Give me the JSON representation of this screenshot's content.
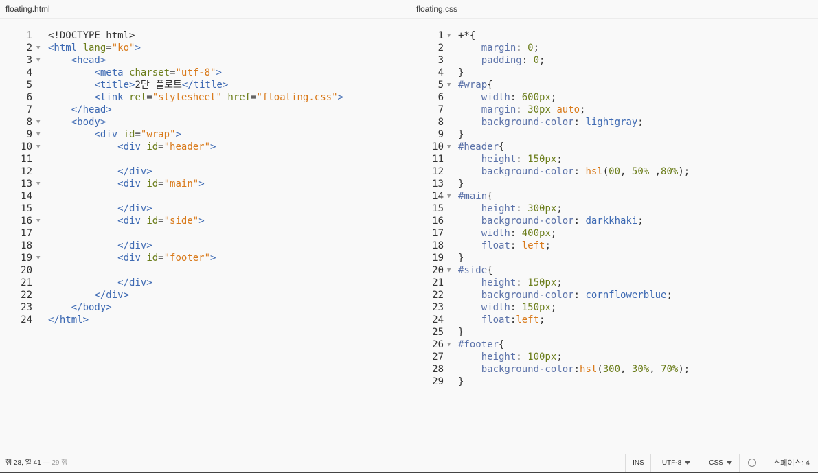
{
  "left_pane": {
    "filename": "floating.html",
    "lines": [
      {
        "n": "1",
        "fold": false,
        "tokens": [
          [
            "plain",
            "<!DOCTYPE html>"
          ]
        ]
      },
      {
        "n": "2",
        "fold": true,
        "tokens": [
          [
            "tag",
            "<html "
          ],
          [
            "attr",
            "lang"
          ],
          [
            "plain",
            "="
          ],
          [
            "str",
            "\"ko\""
          ],
          [
            "tag",
            ">"
          ]
        ]
      },
      {
        "n": "3",
        "fold": true,
        "tokens": [
          [
            "plain",
            "    "
          ],
          [
            "tag",
            "<head>"
          ]
        ]
      },
      {
        "n": "4",
        "fold": false,
        "tokens": [
          [
            "plain",
            "        "
          ],
          [
            "tag",
            "<meta "
          ],
          [
            "attr",
            "charset"
          ],
          [
            "plain",
            "="
          ],
          [
            "str",
            "\"utf-8\""
          ],
          [
            "tag",
            ">"
          ]
        ]
      },
      {
        "n": "5",
        "fold": false,
        "tokens": [
          [
            "plain",
            "        "
          ],
          [
            "tag",
            "<title>"
          ],
          [
            "plain",
            "2단 플로트"
          ],
          [
            "tag",
            "</title>"
          ]
        ]
      },
      {
        "n": "6",
        "fold": false,
        "tokens": [
          [
            "plain",
            "        "
          ],
          [
            "tag",
            "<link "
          ],
          [
            "attr",
            "rel"
          ],
          [
            "plain",
            "="
          ],
          [
            "str",
            "\"stylesheet\""
          ],
          [
            "plain",
            " "
          ],
          [
            "attr",
            "href"
          ],
          [
            "plain",
            "="
          ],
          [
            "str",
            "\"floating.css\""
          ],
          [
            "tag",
            ">"
          ]
        ]
      },
      {
        "n": "7",
        "fold": false,
        "tokens": [
          [
            "plain",
            "    "
          ],
          [
            "tag",
            "</head>"
          ]
        ]
      },
      {
        "n": "8",
        "fold": true,
        "tokens": [
          [
            "plain",
            "    "
          ],
          [
            "tag",
            "<body>"
          ]
        ]
      },
      {
        "n": "9",
        "fold": true,
        "tokens": [
          [
            "plain",
            "        "
          ],
          [
            "tag",
            "<div "
          ],
          [
            "attr",
            "id"
          ],
          [
            "plain",
            "="
          ],
          [
            "str",
            "\"wrap\""
          ],
          [
            "tag",
            ">"
          ]
        ]
      },
      {
        "n": "10",
        "fold": true,
        "tokens": [
          [
            "plain",
            "            "
          ],
          [
            "tag",
            "<div "
          ],
          [
            "attr",
            "id"
          ],
          [
            "plain",
            "="
          ],
          [
            "str",
            "\"header\""
          ],
          [
            "tag",
            ">"
          ]
        ]
      },
      {
        "n": "11",
        "fold": false,
        "tokens": []
      },
      {
        "n": "12",
        "fold": false,
        "tokens": [
          [
            "plain",
            "            "
          ],
          [
            "tag",
            "</div>"
          ]
        ]
      },
      {
        "n": "13",
        "fold": true,
        "tokens": [
          [
            "plain",
            "            "
          ],
          [
            "tag",
            "<div "
          ],
          [
            "attr",
            "id"
          ],
          [
            "plain",
            "="
          ],
          [
            "str",
            "\"main\""
          ],
          [
            "tag",
            ">"
          ]
        ]
      },
      {
        "n": "14",
        "fold": false,
        "tokens": []
      },
      {
        "n": "15",
        "fold": false,
        "tokens": [
          [
            "plain",
            "            "
          ],
          [
            "tag",
            "</div>"
          ]
        ]
      },
      {
        "n": "16",
        "fold": true,
        "tokens": [
          [
            "plain",
            "            "
          ],
          [
            "tag",
            "<div "
          ],
          [
            "attr",
            "id"
          ],
          [
            "plain",
            "="
          ],
          [
            "str",
            "\"side\""
          ],
          [
            "tag",
            ">"
          ]
        ]
      },
      {
        "n": "17",
        "fold": false,
        "tokens": []
      },
      {
        "n": "18",
        "fold": false,
        "tokens": [
          [
            "plain",
            "            "
          ],
          [
            "tag",
            "</div>"
          ]
        ]
      },
      {
        "n": "19",
        "fold": true,
        "tokens": [
          [
            "plain",
            "            "
          ],
          [
            "tag",
            "<div "
          ],
          [
            "attr",
            "id"
          ],
          [
            "plain",
            "="
          ],
          [
            "str",
            "\"footer\""
          ],
          [
            "tag",
            ">"
          ]
        ]
      },
      {
        "n": "20",
        "fold": false,
        "tokens": []
      },
      {
        "n": "21",
        "fold": false,
        "tokens": [
          [
            "plain",
            "            "
          ],
          [
            "tag",
            "</div>"
          ]
        ]
      },
      {
        "n": "22",
        "fold": false,
        "tokens": [
          [
            "plain",
            "        "
          ],
          [
            "tag",
            "</div>"
          ]
        ]
      },
      {
        "n": "23",
        "fold": false,
        "tokens": [
          [
            "plain",
            "    "
          ],
          [
            "tag",
            "</body>"
          ]
        ]
      },
      {
        "n": "24",
        "fold": false,
        "tokens": [
          [
            "tag",
            "</html>"
          ]
        ]
      }
    ]
  },
  "right_pane": {
    "filename": "floating.css",
    "lines": [
      {
        "n": "1",
        "fold": true,
        "tokens": [
          [
            "plain",
            "+*{"
          ]
        ]
      },
      {
        "n": "2",
        "fold": false,
        "tokens": [
          [
            "plain",
            "    "
          ],
          [
            "prop",
            "margin"
          ],
          [
            "plain",
            ": "
          ],
          [
            "num",
            "0"
          ],
          [
            "plain",
            ";"
          ]
        ]
      },
      {
        "n": "3",
        "fold": false,
        "tokens": [
          [
            "plain",
            "    "
          ],
          [
            "prop",
            "padding"
          ],
          [
            "plain",
            ": "
          ],
          [
            "num",
            "0"
          ],
          [
            "plain",
            ";"
          ]
        ]
      },
      {
        "n": "4",
        "fold": false,
        "tokens": [
          [
            "plain",
            "}"
          ]
        ]
      },
      {
        "n": "5",
        "fold": true,
        "tokens": [
          [
            "sel",
            "#wrap"
          ],
          [
            "plain",
            "{"
          ]
        ]
      },
      {
        "n": "6",
        "fold": false,
        "tokens": [
          [
            "plain",
            "    "
          ],
          [
            "prop",
            "width"
          ],
          [
            "plain",
            ": "
          ],
          [
            "num",
            "600px"
          ],
          [
            "plain",
            ";"
          ]
        ]
      },
      {
        "n": "7",
        "fold": false,
        "tokens": [
          [
            "plain",
            "    "
          ],
          [
            "prop",
            "margin"
          ],
          [
            "plain",
            ": "
          ],
          [
            "num",
            "30px"
          ],
          [
            "plain",
            " "
          ],
          [
            "kw",
            "auto"
          ],
          [
            "plain",
            ";"
          ]
        ]
      },
      {
        "n": "8",
        "fold": false,
        "tokens": [
          [
            "plain",
            "    "
          ],
          [
            "prop",
            "background-color"
          ],
          [
            "plain",
            ": "
          ],
          [
            "tag",
            "lightgray"
          ],
          [
            "plain",
            ";"
          ]
        ]
      },
      {
        "n": "9",
        "fold": false,
        "tokens": [
          [
            "plain",
            "}"
          ]
        ]
      },
      {
        "n": "10",
        "fold": true,
        "tokens": [
          [
            "sel",
            "#header"
          ],
          [
            "plain",
            "{"
          ]
        ]
      },
      {
        "n": "11",
        "fold": false,
        "tokens": [
          [
            "plain",
            "    "
          ],
          [
            "prop",
            "height"
          ],
          [
            "plain",
            ": "
          ],
          [
            "num",
            "150px"
          ],
          [
            "plain",
            ";"
          ]
        ]
      },
      {
        "n": "12",
        "fold": false,
        "tokens": [
          [
            "plain",
            "    "
          ],
          [
            "prop",
            "background-color"
          ],
          [
            "plain",
            ": "
          ],
          [
            "kw",
            "hsl"
          ],
          [
            "plain",
            "("
          ],
          [
            "num",
            "00"
          ],
          [
            "plain",
            ", "
          ],
          [
            "num",
            "50%"
          ],
          [
            "plain",
            " ,"
          ],
          [
            "num",
            "80%"
          ],
          [
            "plain",
            ");"
          ]
        ]
      },
      {
        "n": "13",
        "fold": false,
        "tokens": [
          [
            "plain",
            "}"
          ]
        ]
      },
      {
        "n": "14",
        "fold": true,
        "tokens": [
          [
            "sel",
            "#main"
          ],
          [
            "plain",
            "{"
          ]
        ]
      },
      {
        "n": "15",
        "fold": false,
        "tokens": [
          [
            "plain",
            "    "
          ],
          [
            "prop",
            "height"
          ],
          [
            "plain",
            ": "
          ],
          [
            "num",
            "300px"
          ],
          [
            "plain",
            ";"
          ]
        ]
      },
      {
        "n": "16",
        "fold": false,
        "tokens": [
          [
            "plain",
            "    "
          ],
          [
            "prop",
            "background-color"
          ],
          [
            "plain",
            ": "
          ],
          [
            "tag",
            "darkkhaki"
          ],
          [
            "plain",
            ";"
          ]
        ]
      },
      {
        "n": "17",
        "fold": false,
        "tokens": [
          [
            "plain",
            "    "
          ],
          [
            "prop",
            "width"
          ],
          [
            "plain",
            ": "
          ],
          [
            "num",
            "400px"
          ],
          [
            "plain",
            ";"
          ]
        ]
      },
      {
        "n": "18",
        "fold": false,
        "tokens": [
          [
            "plain",
            "    "
          ],
          [
            "prop",
            "float"
          ],
          [
            "plain",
            ": "
          ],
          [
            "kw",
            "left"
          ],
          [
            "plain",
            ";"
          ]
        ]
      },
      {
        "n": "19",
        "fold": false,
        "tokens": [
          [
            "plain",
            "}"
          ]
        ]
      },
      {
        "n": "20",
        "fold": true,
        "tokens": [
          [
            "sel",
            "#side"
          ],
          [
            "plain",
            "{"
          ]
        ]
      },
      {
        "n": "21",
        "fold": false,
        "tokens": [
          [
            "plain",
            "    "
          ],
          [
            "prop",
            "height"
          ],
          [
            "plain",
            ": "
          ],
          [
            "num",
            "150px"
          ],
          [
            "plain",
            ";"
          ]
        ]
      },
      {
        "n": "22",
        "fold": false,
        "tokens": [
          [
            "plain",
            "    "
          ],
          [
            "prop",
            "background-color"
          ],
          [
            "plain",
            ": "
          ],
          [
            "tag",
            "cornflowerblue"
          ],
          [
            "plain",
            ";"
          ]
        ]
      },
      {
        "n": "23",
        "fold": false,
        "tokens": [
          [
            "plain",
            "    "
          ],
          [
            "prop",
            "width"
          ],
          [
            "plain",
            ": "
          ],
          [
            "num",
            "150px"
          ],
          [
            "plain",
            ";"
          ]
        ]
      },
      {
        "n": "24",
        "fold": false,
        "tokens": [
          [
            "plain",
            "    "
          ],
          [
            "prop",
            "float"
          ],
          [
            "plain",
            ":"
          ],
          [
            "kw",
            "left"
          ],
          [
            "plain",
            ";"
          ]
        ]
      },
      {
        "n": "25",
        "fold": false,
        "tokens": [
          [
            "plain",
            "}"
          ]
        ]
      },
      {
        "n": "26",
        "fold": true,
        "tokens": [
          [
            "sel",
            "#footer"
          ],
          [
            "plain",
            "{"
          ]
        ]
      },
      {
        "n": "27",
        "fold": false,
        "tokens": [
          [
            "plain",
            "    "
          ],
          [
            "prop",
            "height"
          ],
          [
            "plain",
            ": "
          ],
          [
            "num",
            "100px"
          ],
          [
            "plain",
            ";"
          ]
        ]
      },
      {
        "n": "28",
        "fold": false,
        "tokens": [
          [
            "plain",
            "    "
          ],
          [
            "prop",
            "background-color"
          ],
          [
            "plain",
            ":"
          ],
          [
            "kw",
            "hsl"
          ],
          [
            "plain",
            "("
          ],
          [
            "num",
            "300"
          ],
          [
            "plain",
            ", "
          ],
          [
            "num",
            "30%"
          ],
          [
            "plain",
            ", "
          ],
          [
            "num",
            "70%"
          ],
          [
            "plain",
            ");"
          ]
        ]
      },
      {
        "n": "29",
        "fold": false,
        "tokens": [
          [
            "plain",
            "}"
          ]
        ]
      }
    ]
  },
  "statusbar": {
    "cursor_position": "행 28, 열 41",
    "line_count": "— 29 행",
    "ins_label": "INS",
    "encoding": "UTF-8",
    "language": "CSS",
    "indent": "스페이스: 4"
  },
  "icons": {
    "fold_marker": "fold-triangle-icon",
    "dropdown": "chevron-down-icon",
    "linter": "circle-icon"
  }
}
